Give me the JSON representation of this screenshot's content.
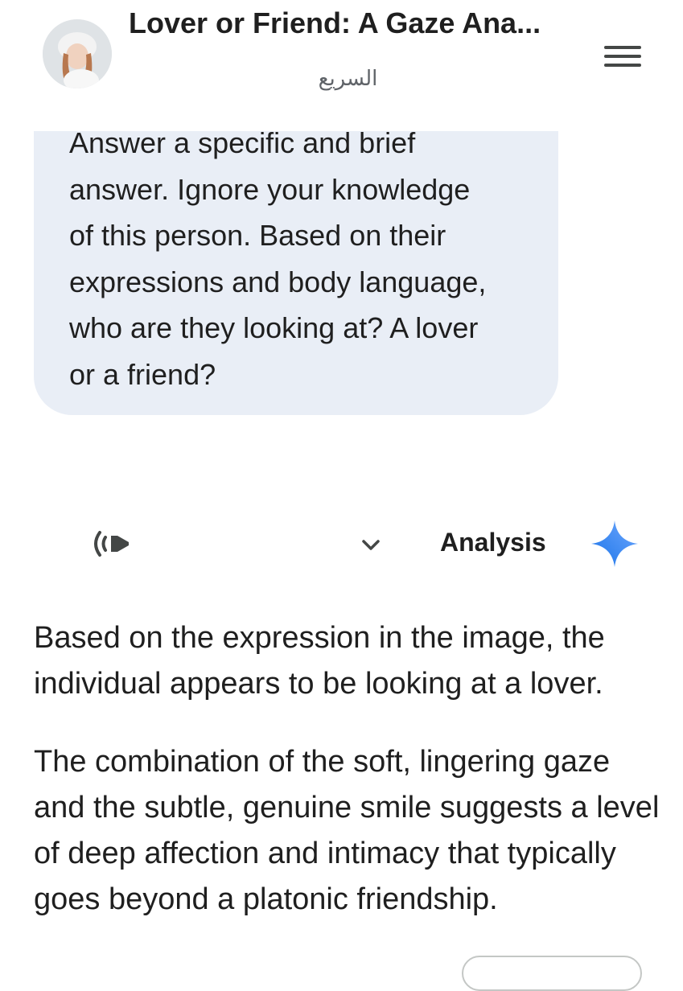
{
  "header": {
    "title": "Lover or Friend: A Gaze Ana...",
    "subtitle": "السريع",
    "avatar_icon": "profile-avatar",
    "menu_icon": "hamburger-menu-icon"
  },
  "prompt": {
    "lines": [
      "Answer a specific and brief",
      "answer. Ignore your knowledge",
      "of this person. Based on their",
      "expressions and body language,",
      "who are they looking at? A lover",
      "or a friend?"
    ]
  },
  "response_header": {
    "speaker_icon": "volume-icon",
    "chevron_icon": "chevron-down-icon",
    "label": "Analysis",
    "sparkle_icon": "gemini-sparkle-icon",
    "accent_color": "#4285f4"
  },
  "response": {
    "paragraph_1": "Based on the expression in the image, the individual appears to be looking at a lover.",
    "paragraph_2": "The combination of the soft, lingering gaze and the subtle, genuine smile suggests a level of deep affection and intimacy that typically goes beyond a platonic friendship."
  }
}
